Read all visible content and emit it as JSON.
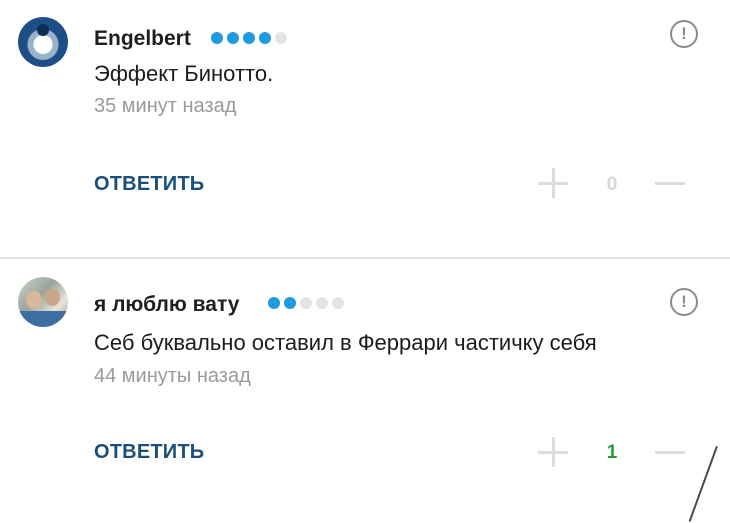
{
  "comments": [
    {
      "author": "Engelbert",
      "rating_dots_filled": 4,
      "rating_dots_total": 5,
      "text": "Эффект Бинотто.",
      "time": "35 минут назад",
      "reply_label": "ОТВЕТИТЬ",
      "score": "0",
      "report_symbol": "!"
    },
    {
      "author": "я люблю вату",
      "rating_dots_filled": 2,
      "rating_dots_total": 5,
      "text": "Себ буквально оставил в Феррари частичку себя",
      "time": "44 минуты назад",
      "reply_label": "ОТВЕТИТЬ",
      "score": "1",
      "report_symbol": "!"
    }
  ],
  "colors": {
    "rating_active": "#1e9be0",
    "rating_inactive": "#e4e4e4",
    "reply": "#1a4f7a",
    "score_positive": "#2a9a3a",
    "score_zero": "#d6d6d6"
  },
  "icons": {
    "report": "exclamation-circle-icon",
    "upvote": "plus-icon",
    "downvote": "minus-icon"
  }
}
